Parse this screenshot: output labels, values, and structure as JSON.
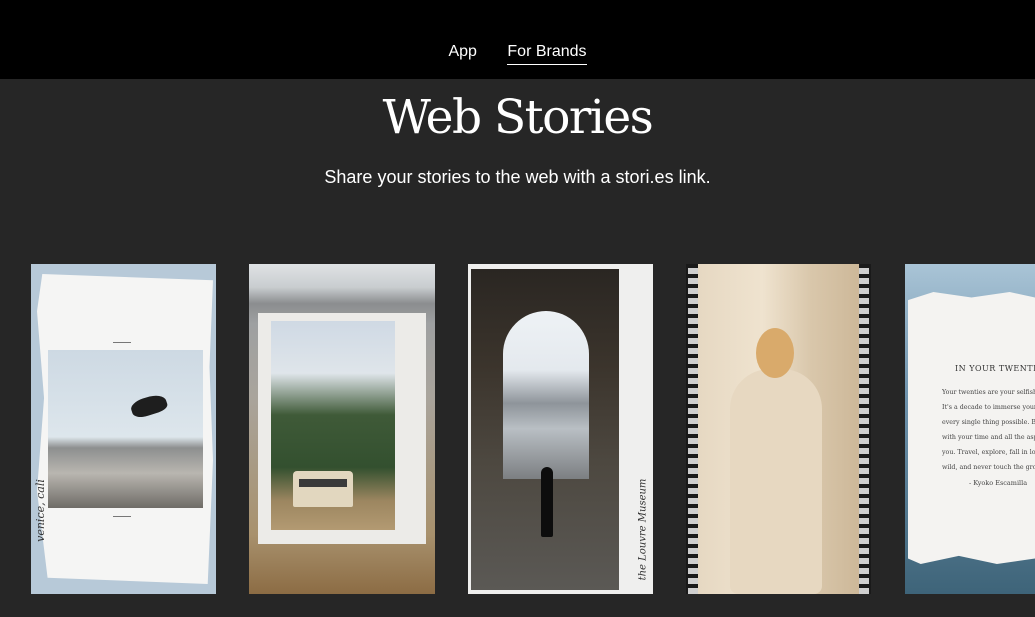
{
  "nav": {
    "items": [
      {
        "label": "App"
      },
      {
        "label": "For Brands"
      }
    ]
  },
  "hero": {
    "title": "Web Stories",
    "subtitle": "Share your stories to the web with a stori.es link."
  },
  "cards": [
    {
      "caption": "venice, cali"
    },
    {
      "caption": ""
    },
    {
      "caption": "the Louvre Museum"
    },
    {
      "caption": ""
    },
    {
      "title": "IN YOUR TWENTIES",
      "lines": [
        "Your twenties are your selfish",
        "It's a decade to immerse yours",
        "every single thing possible. Be",
        "with your time and all the aspe",
        "you. Travel, explore, fall in lov",
        "wild, and never touch the gro"
      ],
      "signature": "- Kyoko Escamilla"
    }
  ]
}
